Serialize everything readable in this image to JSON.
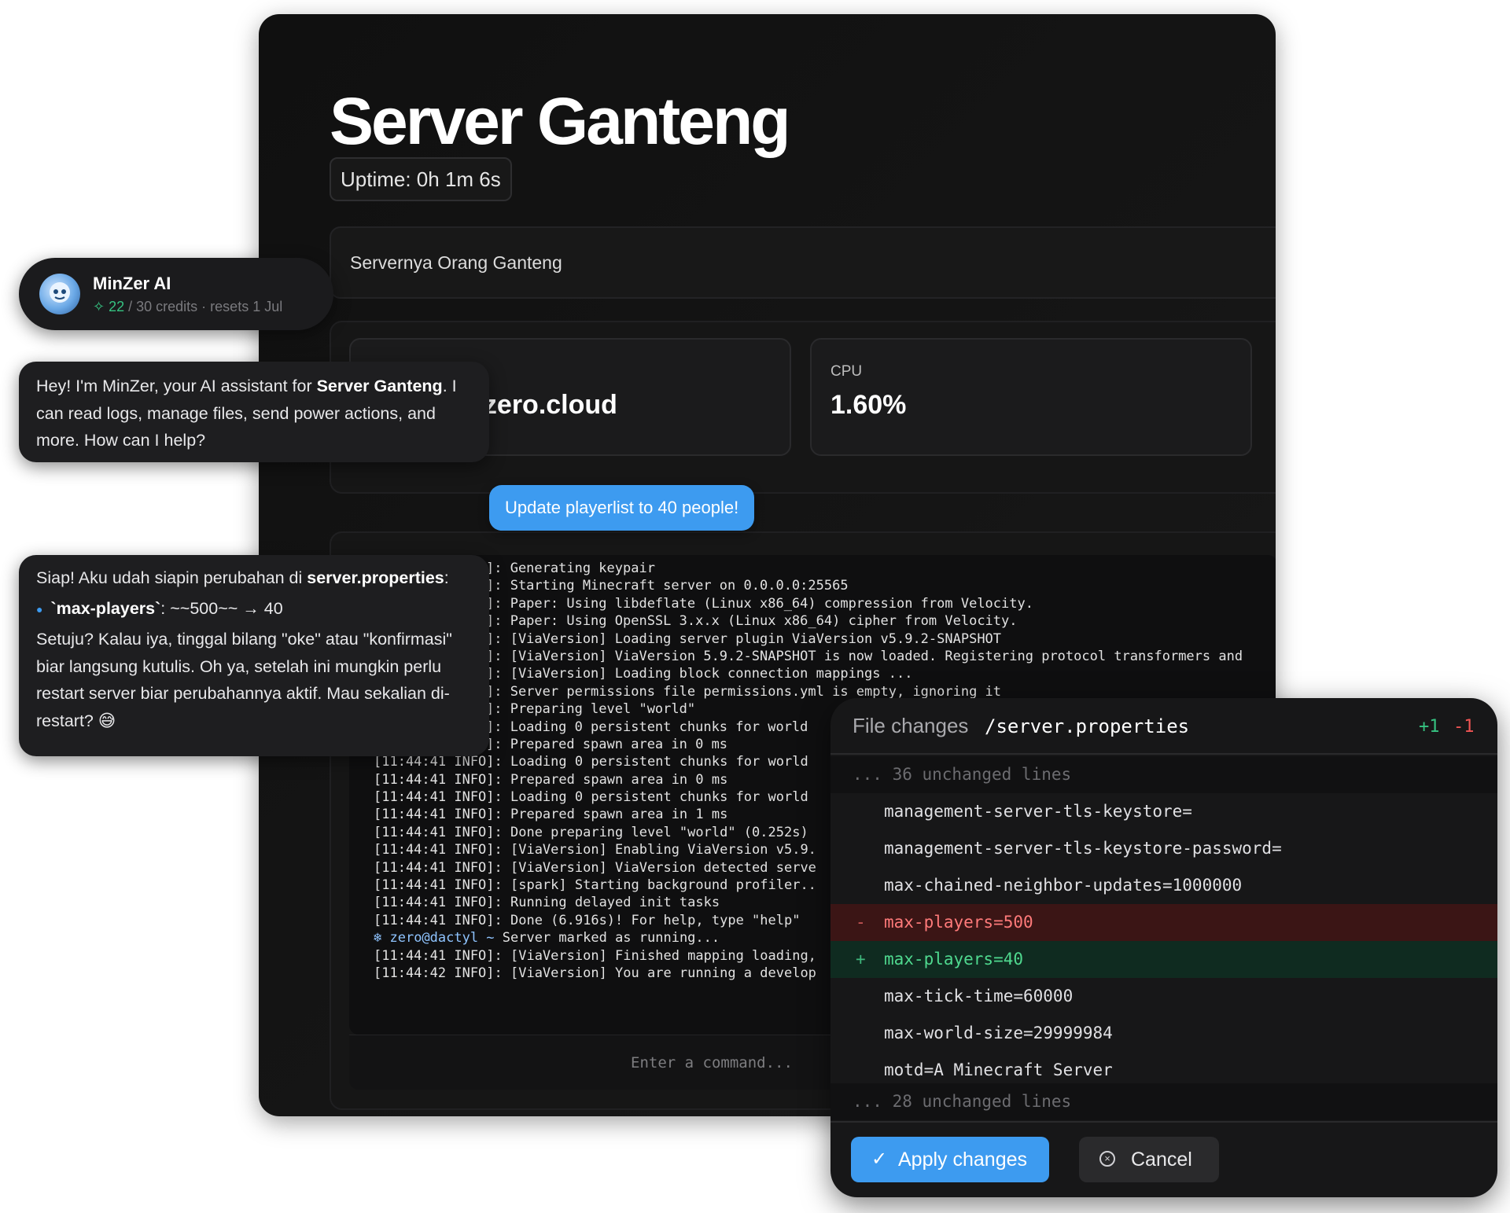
{
  "server": {
    "name": "Server Ganteng",
    "uptime": "Uptime: 0h 1m 6s",
    "description": "Servernya Orang Ganteng"
  },
  "stats": {
    "address_value": "yzero.cloud",
    "cpu_label": "CPU",
    "cpu_value": "1.60%"
  },
  "console": {
    "lines": [
      "]: Generating keypair",
      "]: Starting Minecraft server on 0.0.0.0:25565",
      "]: Paper: Using libdeflate (Linux x86_64) compression from Velocity.",
      "]: Paper: Using OpenSSL 3.x.x (Linux x86_64) cipher from Velocity.",
      "]: [ViaVersion] Loading server plugin ViaVersion v5.9.2-SNAPSHOT",
      "]: [ViaVersion] ViaVersion 5.9.2-SNAPSHOT is now loaded. Registering protocol transformers and",
      "]: [ViaVersion] Loading block connection mappings ...",
      "]: Server permissions file permissions.yml is empty, ignoring it",
      "]: Preparing level \"world\"",
      "]: Loading 0 persistent chunks for world",
      "]: Prepared spawn area in 0 ms",
      "[11:44:41 INFO]: Loading 0 persistent chunks for world",
      "[11:44:41 INFO]: Prepared spawn area in 0 ms",
      "[11:44:41 INFO]: Loading 0 persistent chunks for world",
      "[11:44:41 INFO]: Prepared spawn area in 1 ms",
      "[11:44:41 INFO]: Done preparing level \"world\" (0.252s)",
      "[11:44:41 INFO]: [ViaVersion] Enabling ViaVersion v5.9.",
      "[11:44:41 INFO]: [ViaVersion] ViaVersion detected serve",
      "[11:44:41 INFO]: [spark] Starting background profiler..",
      "[11:44:41 INFO]: Running delayed init tasks",
      "[11:44:41 INFO]: Done (6.916s)! For help, type \"help\""
    ],
    "prompt_icon": "pterodactyl-icon",
    "prompt_user": "zero@dactyl ~",
    "prompt_text": " Server marked as running...",
    "lines_after": [
      "[11:44:41 INFO]: [ViaVersion] Finished mapping loading,",
      "[11:44:42 INFO]: [ViaVersion] You are running a develop"
    ],
    "command_placeholder": "Enter a command..."
  },
  "chat": {
    "assistant_name": "MinZer AI",
    "credits_used": "22",
    "credits_rest": " / 30 credits · resets 1 Jul",
    "greeting_pre": "Hey! I'm MinZer, your AI assistant for ",
    "greeting_bold": "Server Ganteng",
    "greeting_post": ". I can read logs, manage files, send power actions, and more. How can I help?",
    "user_message": "Update playerlist to 40 people!",
    "reply_intro_pre": "Siap! Aku udah siapin perubahan di ",
    "reply_intro_bold": "server.properties",
    "reply_intro_post": ":",
    "reply_bullet_key": "`max-players`",
    "reply_bullet_rest": ": ~~500~~ → 40",
    "reply_body": "Setuju? Kalau iya, tinggal bilang \"oke\" atau \"konfirmasi\" biar langsung kutulis. Oh ya, setelah ini mungkin perlu restart server biar perubahannya aktif. Mau sekalian di-restart? 😅"
  },
  "file_changes": {
    "title": "File changes",
    "path": "/server.properties",
    "added": "+1",
    "removed": "-1",
    "fold_top": "... 36 unchanged lines",
    "context_before": [
      "management-server-tls-keystore=",
      "management-server-tls-keystore-password=",
      "max-chained-neighbor-updates=1000000"
    ],
    "removed_line": "max-players=500",
    "added_line": "max-players=40",
    "context_after": [
      "max-tick-time=60000",
      "max-world-size=29999984",
      "motd=A Minecraft Server"
    ],
    "fold_bottom": "... 28 unchanged lines",
    "apply_label": "Apply changes",
    "cancel_label": "Cancel"
  },
  "colors": {
    "accent": "#3d9bf0",
    "added": "#36c281",
    "removed": "#f05454"
  }
}
